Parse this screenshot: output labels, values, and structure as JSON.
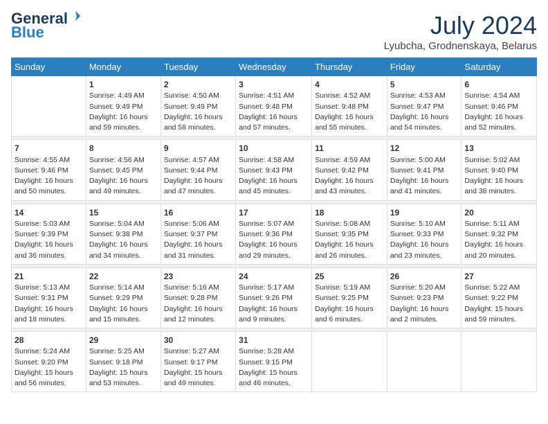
{
  "header": {
    "logo_general": "General",
    "logo_blue": "Blue",
    "month_title": "July 2024",
    "location": "Lyubcha, Grodnenskaya, Belarus"
  },
  "days_of_week": [
    "Sunday",
    "Monday",
    "Tuesday",
    "Wednesday",
    "Thursday",
    "Friday",
    "Saturday"
  ],
  "weeks": [
    [
      {
        "day": "",
        "sunrise": "",
        "sunset": "",
        "daylight": ""
      },
      {
        "day": "1",
        "sunrise": "Sunrise: 4:49 AM",
        "sunset": "Sunset: 9:49 PM",
        "daylight": "Daylight: 16 hours and 59 minutes."
      },
      {
        "day": "2",
        "sunrise": "Sunrise: 4:50 AM",
        "sunset": "Sunset: 9:49 PM",
        "daylight": "Daylight: 16 hours and 58 minutes."
      },
      {
        "day": "3",
        "sunrise": "Sunrise: 4:51 AM",
        "sunset": "Sunset: 9:48 PM",
        "daylight": "Daylight: 16 hours and 57 minutes."
      },
      {
        "day": "4",
        "sunrise": "Sunrise: 4:52 AM",
        "sunset": "Sunset: 9:48 PM",
        "daylight": "Daylight: 16 hours and 55 minutes."
      },
      {
        "day": "5",
        "sunrise": "Sunrise: 4:53 AM",
        "sunset": "Sunset: 9:47 PM",
        "daylight": "Daylight: 16 hours and 54 minutes."
      },
      {
        "day": "6",
        "sunrise": "Sunrise: 4:54 AM",
        "sunset": "Sunset: 9:46 PM",
        "daylight": "Daylight: 16 hours and 52 minutes."
      }
    ],
    [
      {
        "day": "7",
        "sunrise": "Sunrise: 4:55 AM",
        "sunset": "Sunset: 9:46 PM",
        "daylight": "Daylight: 16 hours and 50 minutes."
      },
      {
        "day": "8",
        "sunrise": "Sunrise: 4:56 AM",
        "sunset": "Sunset: 9:45 PM",
        "daylight": "Daylight: 16 hours and 49 minutes."
      },
      {
        "day": "9",
        "sunrise": "Sunrise: 4:57 AM",
        "sunset": "Sunset: 9:44 PM",
        "daylight": "Daylight: 16 hours and 47 minutes."
      },
      {
        "day": "10",
        "sunrise": "Sunrise: 4:58 AM",
        "sunset": "Sunset: 9:43 PM",
        "daylight": "Daylight: 16 hours and 45 minutes."
      },
      {
        "day": "11",
        "sunrise": "Sunrise: 4:59 AM",
        "sunset": "Sunset: 9:42 PM",
        "daylight": "Daylight: 16 hours and 43 minutes."
      },
      {
        "day": "12",
        "sunrise": "Sunrise: 5:00 AM",
        "sunset": "Sunset: 9:41 PM",
        "daylight": "Daylight: 16 hours and 41 minutes."
      },
      {
        "day": "13",
        "sunrise": "Sunrise: 5:02 AM",
        "sunset": "Sunset: 9:40 PM",
        "daylight": "Daylight: 16 hours and 38 minutes."
      }
    ],
    [
      {
        "day": "14",
        "sunrise": "Sunrise: 5:03 AM",
        "sunset": "Sunset: 9:39 PM",
        "daylight": "Daylight: 16 hours and 36 minutes."
      },
      {
        "day": "15",
        "sunrise": "Sunrise: 5:04 AM",
        "sunset": "Sunset: 9:38 PM",
        "daylight": "Daylight: 16 hours and 34 minutes."
      },
      {
        "day": "16",
        "sunrise": "Sunrise: 5:06 AM",
        "sunset": "Sunset: 9:37 PM",
        "daylight": "Daylight: 16 hours and 31 minutes."
      },
      {
        "day": "17",
        "sunrise": "Sunrise: 5:07 AM",
        "sunset": "Sunset: 9:36 PM",
        "daylight": "Daylight: 16 hours and 29 minutes."
      },
      {
        "day": "18",
        "sunrise": "Sunrise: 5:08 AM",
        "sunset": "Sunset: 9:35 PM",
        "daylight": "Daylight: 16 hours and 26 minutes."
      },
      {
        "day": "19",
        "sunrise": "Sunrise: 5:10 AM",
        "sunset": "Sunset: 9:33 PM",
        "daylight": "Daylight: 16 hours and 23 minutes."
      },
      {
        "day": "20",
        "sunrise": "Sunrise: 5:11 AM",
        "sunset": "Sunset: 9:32 PM",
        "daylight": "Daylight: 16 hours and 20 minutes."
      }
    ],
    [
      {
        "day": "21",
        "sunrise": "Sunrise: 5:13 AM",
        "sunset": "Sunset: 9:31 PM",
        "daylight": "Daylight: 16 hours and 18 minutes."
      },
      {
        "day": "22",
        "sunrise": "Sunrise: 5:14 AM",
        "sunset": "Sunset: 9:29 PM",
        "daylight": "Daylight: 16 hours and 15 minutes."
      },
      {
        "day": "23",
        "sunrise": "Sunrise: 5:16 AM",
        "sunset": "Sunset: 9:28 PM",
        "daylight": "Daylight: 16 hours and 12 minutes."
      },
      {
        "day": "24",
        "sunrise": "Sunrise: 5:17 AM",
        "sunset": "Sunset: 9:26 PM",
        "daylight": "Daylight: 16 hours and 9 minutes."
      },
      {
        "day": "25",
        "sunrise": "Sunrise: 5:19 AM",
        "sunset": "Sunset: 9:25 PM",
        "daylight": "Daylight: 16 hours and 6 minutes."
      },
      {
        "day": "26",
        "sunrise": "Sunrise: 5:20 AM",
        "sunset": "Sunset: 9:23 PM",
        "daylight": "Daylight: 16 hours and 2 minutes."
      },
      {
        "day": "27",
        "sunrise": "Sunrise: 5:22 AM",
        "sunset": "Sunset: 9:22 PM",
        "daylight": "Daylight: 15 hours and 59 minutes."
      }
    ],
    [
      {
        "day": "28",
        "sunrise": "Sunrise: 5:24 AM",
        "sunset": "Sunset: 9:20 PM",
        "daylight": "Daylight: 15 hours and 56 minutes."
      },
      {
        "day": "29",
        "sunrise": "Sunrise: 5:25 AM",
        "sunset": "Sunset: 9:18 PM",
        "daylight": "Daylight: 15 hours and 53 minutes."
      },
      {
        "day": "30",
        "sunrise": "Sunrise: 5:27 AM",
        "sunset": "Sunset: 9:17 PM",
        "daylight": "Daylight: 15 hours and 49 minutes."
      },
      {
        "day": "31",
        "sunrise": "Sunrise: 5:28 AM",
        "sunset": "Sunset: 9:15 PM",
        "daylight": "Daylight: 15 hours and 46 minutes."
      },
      {
        "day": "",
        "sunrise": "",
        "sunset": "",
        "daylight": ""
      },
      {
        "day": "",
        "sunrise": "",
        "sunset": "",
        "daylight": ""
      },
      {
        "day": "",
        "sunrise": "",
        "sunset": "",
        "daylight": ""
      }
    ]
  ]
}
